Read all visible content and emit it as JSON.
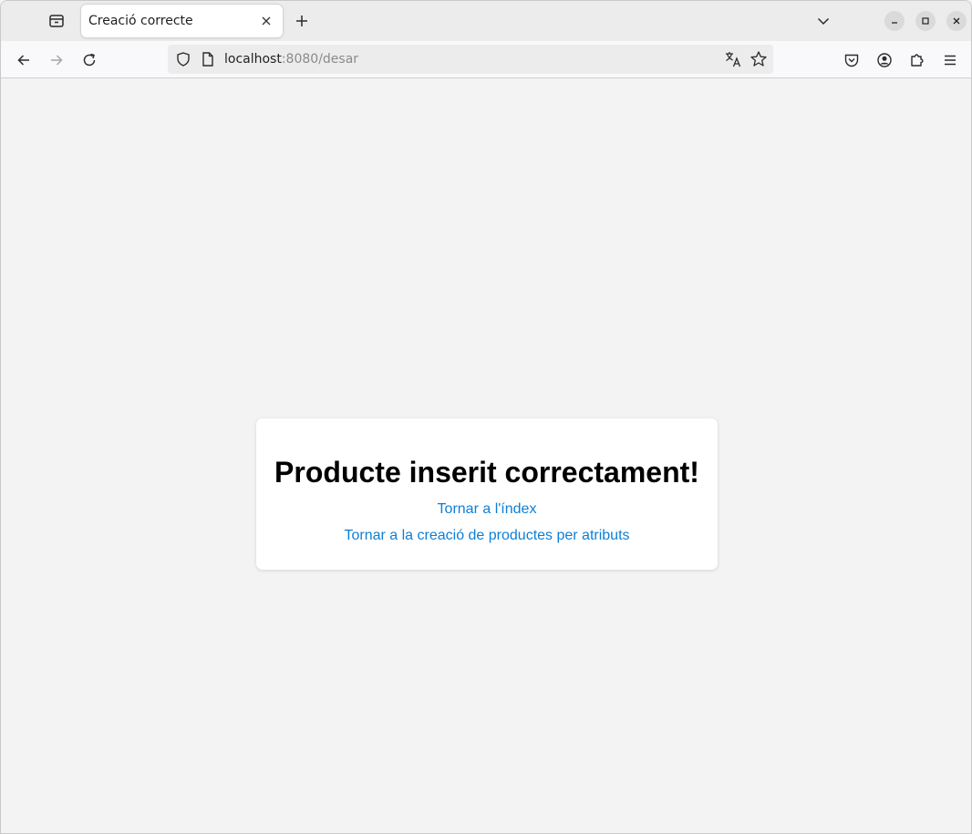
{
  "browser": {
    "tab": {
      "title": "Creació correcte"
    },
    "address": {
      "host": "localhost",
      "rest": ":8080/desar"
    }
  },
  "page": {
    "heading": "Producte inserit correctament!",
    "links": [
      {
        "label": "Tornar a l'índex"
      },
      {
        "label": "Tornar a la creació de productes per atributs"
      }
    ]
  },
  "colors": {
    "link": "#0d7fd6",
    "background": "#f3f3f3",
    "card": "#ffffff"
  }
}
